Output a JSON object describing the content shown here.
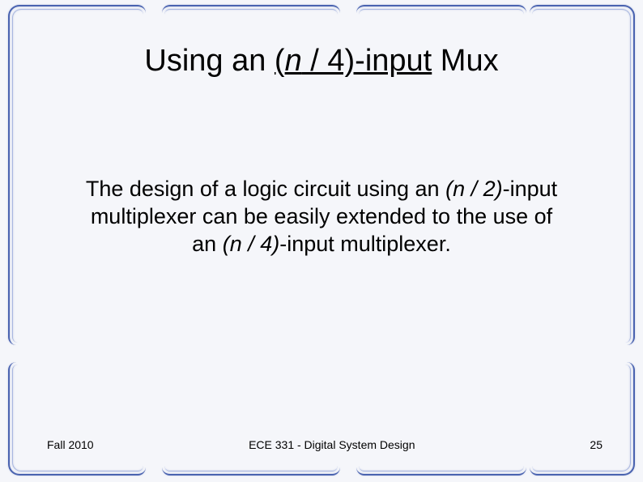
{
  "title": {
    "pre": "Using an ",
    "underlined_open": "(",
    "n": "n",
    "underlined_rest": " / 4)-input",
    "post": " Mux"
  },
  "body": {
    "line1_pre": "The design of a logic circuit using an ",
    "line1_ital": "(n / 2)",
    "line1_post": "-input",
    "line2": "multiplexer can be easily extended to the use of",
    "line3_pre": "an ",
    "line3_ital": "(n / 4)",
    "line3_post": "-input multiplexer."
  },
  "footer": {
    "left": "Fall 2010",
    "center": "ECE 331 - Digital System Design",
    "right": "25"
  }
}
